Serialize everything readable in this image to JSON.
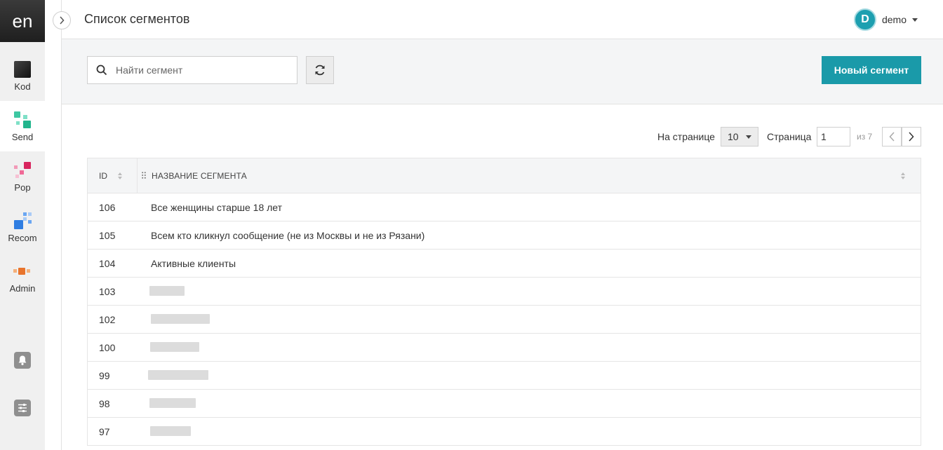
{
  "rail": {
    "logo": "en",
    "items": [
      {
        "label": "Kod"
      },
      {
        "label": "Send"
      },
      {
        "label": "Pop"
      },
      {
        "label": "Recom"
      },
      {
        "label": "Admin"
      }
    ],
    "bottom_icons": [
      "bell-icon",
      "sliders-icon"
    ]
  },
  "header": {
    "title": "Список сегментов",
    "user": {
      "initial": "D",
      "name": "demo"
    }
  },
  "toolbar": {
    "search_placeholder": "Найти сегмент",
    "new_button": "Новый сегмент"
  },
  "pagination": {
    "per_page_label": "На странице",
    "per_page_value": "10",
    "page_label": "Страница",
    "page_value": "1",
    "of_text": "из 7"
  },
  "table": {
    "columns": [
      "ID",
      "НАЗВАНИЕ СЕГМЕНТА"
    ],
    "rows": [
      {
        "id": "106",
        "name": "Все женщины старше 18 лет"
      },
      {
        "id": "105",
        "name": "Всем кто кликнул сообщение (не из Москвы и не из Рязани)"
      },
      {
        "id": "104",
        "name": "Активные клиенты"
      },
      {
        "id": "103",
        "name": ""
      },
      {
        "id": "102",
        "name": ""
      },
      {
        "id": "100",
        "name": ""
      },
      {
        "id": "99",
        "name": ""
      },
      {
        "id": "98",
        "name": ""
      },
      {
        "id": "97",
        "name": ""
      }
    ]
  },
  "colors": {
    "accent": "#1a9aa9",
    "avatar": "#1d9fb0"
  }
}
